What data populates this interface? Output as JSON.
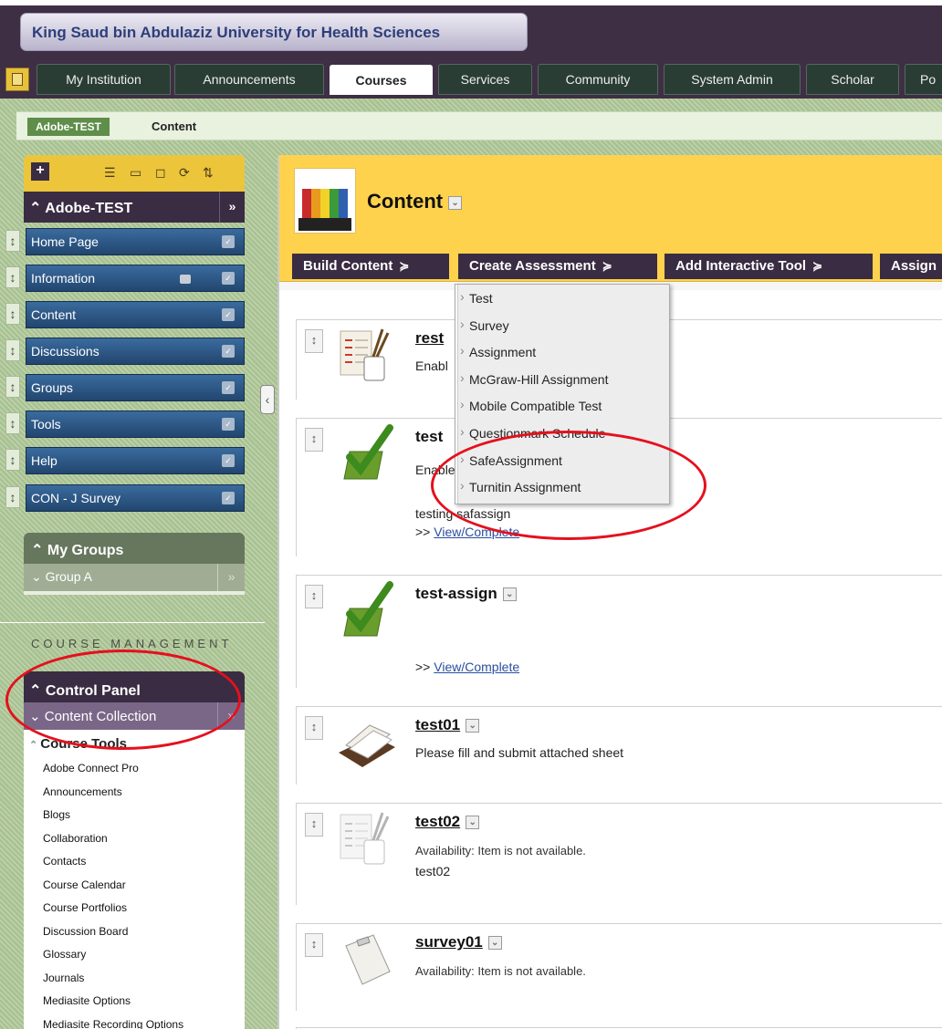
{
  "header": {
    "institution": "King Saud bin Abdulaziz University for Health Sciences",
    "tabs": [
      "My Institution",
      "Announcements",
      "Courses",
      "Services",
      "Community",
      "System Admin",
      "Scholar",
      "Po"
    ],
    "selected_tab": "Courses"
  },
  "breadcrumb": {
    "course": "Adobe-TEST",
    "page": "Content"
  },
  "course_menu": {
    "title": "Adobe-TEST",
    "items": [
      "Home Page",
      "Information",
      "Content",
      "Discussions",
      "Groups",
      "Tools",
      "Help",
      "CON - J Survey"
    ]
  },
  "my_groups": {
    "title": "My Groups",
    "items": [
      "Group A"
    ]
  },
  "course_management": {
    "label": "COURSE MANAGEMENT",
    "control_panel": "Control Panel",
    "content_collection": "Content Collection",
    "course_tools": "Course Tools",
    "tools": [
      "Adobe Connect Pro",
      "Announcements",
      "Blogs",
      "Collaboration",
      "Contacts",
      "Course Calendar",
      "Course Portfolios",
      "Discussion Board",
      "Glossary",
      "Journals",
      "Mediasite Options",
      "Mediasite Recording Options"
    ]
  },
  "content": {
    "title": "Content",
    "action_bar": [
      "Build Content",
      "Create Assessment",
      "Add Interactive Tool",
      "Assign"
    ],
    "assessment_menu": [
      "Test",
      "Survey",
      "Assignment",
      "McGraw-Hill Assignment",
      "Mobile Compatible Test",
      "Questionmark Schedule",
      "SafeAssignment",
      "Turnitin Assignment"
    ],
    "items": [
      {
        "title": "rest",
        "line1": "Enabl"
      },
      {
        "title": "test",
        "line1": "Enable",
        "line2": "testing safassign",
        "link_prefix": ">>",
        "link": "View/Complete"
      },
      {
        "title": "test-assign",
        "link_prefix": ">>",
        "link": "View/Complete"
      },
      {
        "title": "test01",
        "line1": "Please fill and submit attached sheet"
      },
      {
        "title": "test02",
        "line1": "Availability:  Item is not available.",
        "line2": "test02"
      },
      {
        "title": "survey01",
        "line1": "Availability:  Item is not available."
      }
    ]
  },
  "colors": {
    "header_bg": "#3e2f45",
    "accent_yellow": "#fed24d",
    "menu_blue": "#2d5a8a",
    "annotation_red": "#e5101d"
  }
}
